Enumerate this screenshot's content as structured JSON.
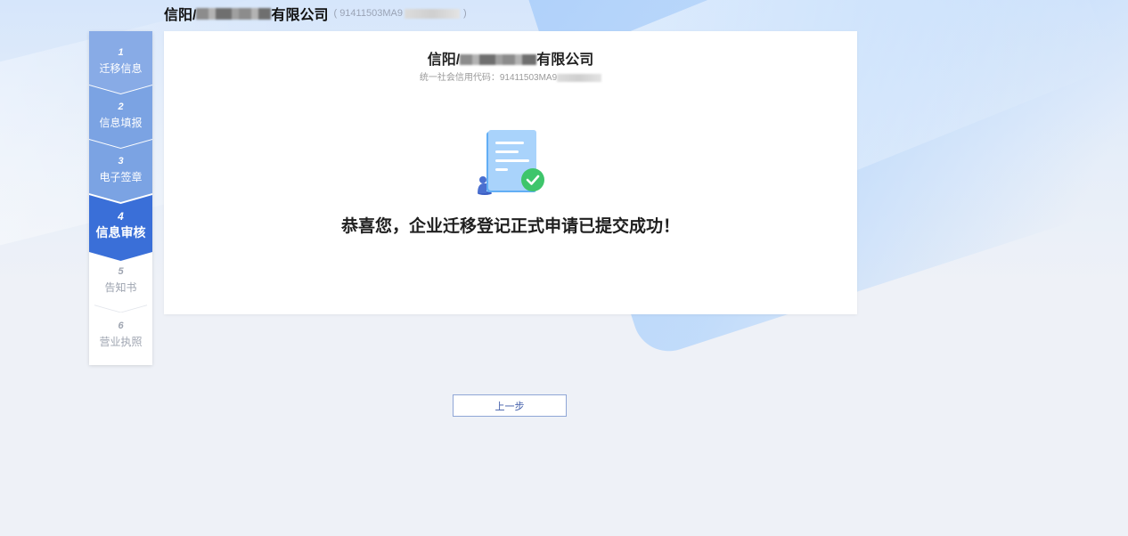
{
  "header": {
    "company_prefix": "信阳/",
    "company_suffix": "有限公司",
    "code_open": "( 91411503MA9",
    "code_close": ")"
  },
  "steps": [
    {
      "num": "1",
      "label": "迁移信息",
      "state": "done"
    },
    {
      "num": "2",
      "label": "信息填报",
      "state": "done"
    },
    {
      "num": "3",
      "label": "电子签章",
      "state": "done"
    },
    {
      "num": "4",
      "label": "信息审核",
      "state": "active"
    },
    {
      "num": "5",
      "label": "告知书",
      "state": "todo"
    },
    {
      "num": "6",
      "label": "营业执照",
      "state": "todo"
    }
  ],
  "card": {
    "title_prefix": "信阳/",
    "title_suffix": "有限公司",
    "credit_label": "统一社会信用代码：91411503MA9",
    "message": "恭喜您，企业迁移登记正式申请已提交成功！",
    "illustration_icon": "document-check-icon"
  },
  "actions": {
    "prev_label": "上一步"
  },
  "colors": {
    "step_done": "#7ba3e3",
    "step_active": "#3a6fd8",
    "step_todo_text": "#9ea4b0",
    "check_green": "#3ec56b",
    "doc_blue": "#5aa6f2"
  }
}
